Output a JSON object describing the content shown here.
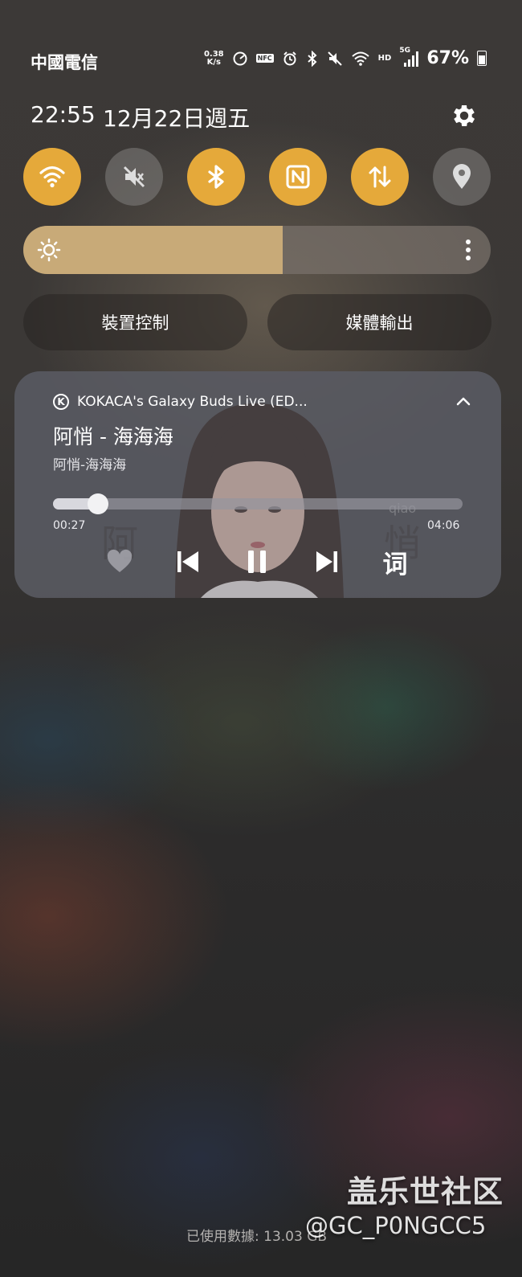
{
  "status_bar": {
    "carrier": "中國電信",
    "net_speed_value": "0.38",
    "net_speed_unit": "K/s",
    "nfc_label": "NFC",
    "hd_label": "HD",
    "network_label": "5G",
    "battery": "67%",
    "icons": [
      "data-saver-icon",
      "nfc-icon",
      "alarm-icon",
      "bluetooth-icon",
      "mute-icon",
      "wifi-icon",
      "signal-icon",
      "battery-icon"
    ]
  },
  "header": {
    "time": "22:55",
    "date": "12月22日週五"
  },
  "quick_toggles": [
    {
      "name": "wifi",
      "icon": "wifi-icon",
      "on": true
    },
    {
      "name": "sound",
      "icon": "mute-icon",
      "on": false
    },
    {
      "name": "bluetooth",
      "icon": "bluetooth-icon",
      "on": true
    },
    {
      "name": "nfc",
      "icon": "nfc-icon",
      "on": true
    },
    {
      "name": "mobile-data",
      "icon": "data-arrows-icon",
      "on": true
    },
    {
      "name": "location",
      "icon": "location-icon",
      "on": false
    }
  ],
  "brightness": {
    "level": 0.555
  },
  "controls": {
    "device_control": "裝置控制",
    "media_output": "媒體輸出"
  },
  "media": {
    "device": "KOKACA's Galaxy Buds Live (ED...",
    "title": "阿悄 - 海海海",
    "subtitle": "阿悄-海海海",
    "current_time": "00:27",
    "total_time": "04:06",
    "progress": 0.11,
    "lyrics_label": "词"
  },
  "footer": {
    "data_usage": "已使用數據: 13.03 GB"
  },
  "watermark": {
    "line1": "盖乐世社区",
    "line2": "@GC_P0NGCC5"
  },
  "colors": {
    "toggle_on": "#e5a93a",
    "brightness_fill": "#c8aa78"
  }
}
